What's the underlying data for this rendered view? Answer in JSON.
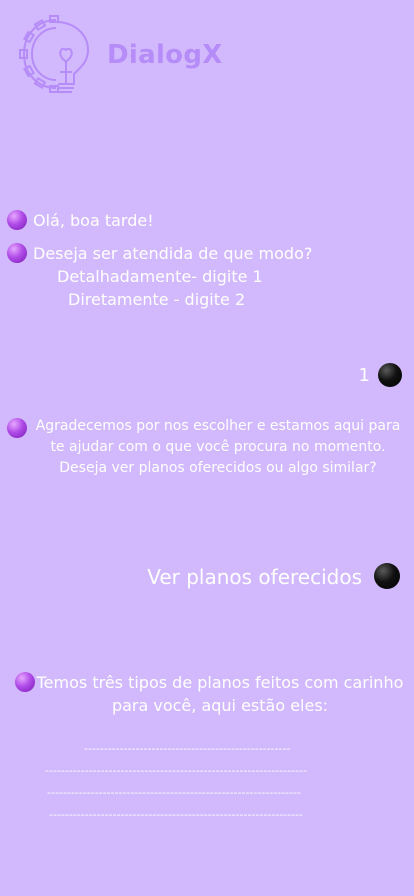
{
  "header": {
    "brand_name": "DialogX",
    "logo_icon": "gear-lightbulb-icon"
  },
  "chat": {
    "bot_greeting": "Olá, boa tarde!",
    "bot_question": "Deseja ser atendida de que modo?",
    "option_1": "Detalhadamente- digite 1",
    "option_2": "Diretamente - digite 2",
    "user_reply_1": "1",
    "bot_thanks": "Agradecemos por nos escolher e estamos aqui para te ajudar com o que você procura no momento. Deseja ver planos oferecidos ou algo similar?",
    "user_reply_2": "Ver planos oferecidos",
    "bot_plans": "Temos  três  tipos  de planos  feitos com carinho para você, aqui estão eles:",
    "plan_lines": [
      "----------------------------------------------------",
      "------------------------------------------------------------------",
      "----------------------------------------------------------------",
      "----------------------------------------------------------------"
    ]
  },
  "colors": {
    "background": "#d2b9fd",
    "brand": "#b68cf8",
    "bot_dot": "#a03fdc",
    "user_dot": "#000000",
    "text": "#ffffff"
  }
}
